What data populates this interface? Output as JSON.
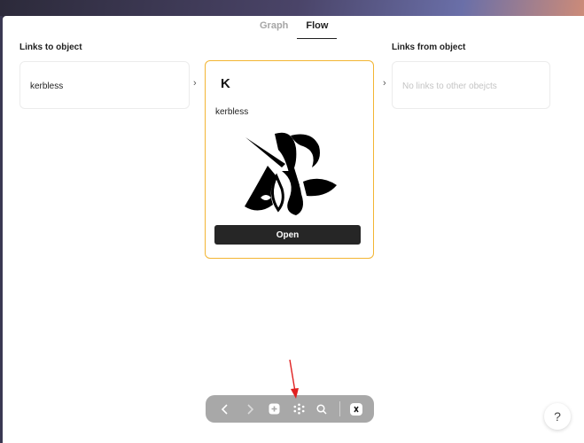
{
  "tabs": [
    {
      "label": "Graph",
      "active": false
    },
    {
      "label": "Flow",
      "active": true
    }
  ],
  "columns": {
    "links_to_title": "Links to object",
    "links_from_title": "Links from object"
  },
  "links_to": [
    {
      "label": "kerbless"
    }
  ],
  "links_from": {
    "empty_text": "No links to other obejcts"
  },
  "center": {
    "icon_letter": "K",
    "title": "kerbless",
    "open_label": "Open",
    "accent": "#f3b533"
  },
  "toolbar": {
    "buttons": [
      "back-icon",
      "forward-icon",
      "plus-icon",
      "graph-icon",
      "search-icon",
      "space-icon"
    ]
  },
  "help_label": "?"
}
